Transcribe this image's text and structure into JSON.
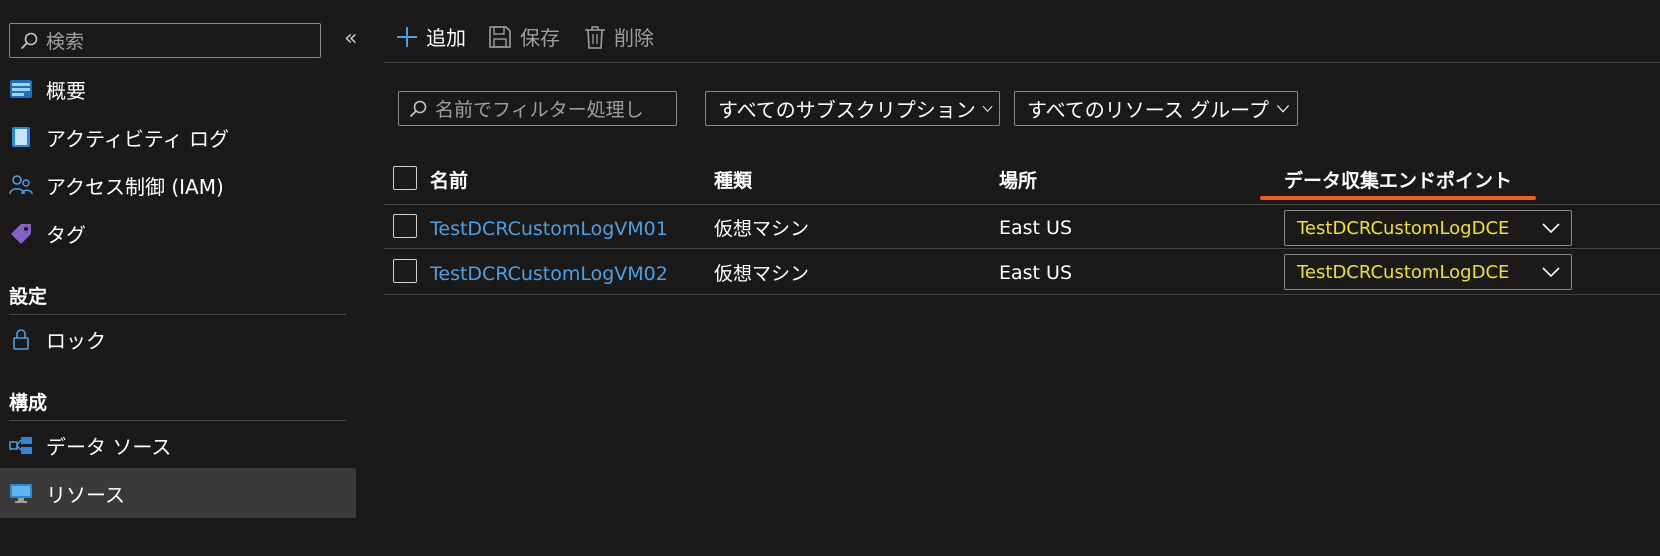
{
  "sidebar": {
    "search_placeholder": "検索",
    "collapse_glyph": "«",
    "items": [
      {
        "label": "概要",
        "icon": "overview-icon"
      },
      {
        "label": "アクティビティ ログ",
        "icon": "activity-log-icon"
      },
      {
        "label": "アクセス制御 (IAM)",
        "icon": "iam-icon"
      },
      {
        "label": "タグ",
        "icon": "tag-icon"
      }
    ],
    "section_settings": "設定",
    "settings_items": [
      {
        "label": "ロック",
        "icon": "lock-icon"
      }
    ],
    "section_config": "構成",
    "config_items": [
      {
        "label": "データ ソース",
        "icon": "data-source-icon"
      },
      {
        "label": "リソース",
        "icon": "resources-icon",
        "selected": true
      }
    ]
  },
  "toolbar": {
    "add_label": "追加",
    "save_label": "保存",
    "delete_label": "削除"
  },
  "filters": {
    "name_placeholder": "名前でフィルター処理し",
    "subscription": "すべてのサブスクリプション",
    "resource_group": "すべてのリソース グループ"
  },
  "table": {
    "headers": {
      "name": "名前",
      "type": "種類",
      "location": "場所",
      "endpoint": "データ収集エンドポイント"
    },
    "rows": [
      {
        "name": "TestDCRCustomLogVM01",
        "type": "仮想マシン",
        "location": "East US",
        "endpoint": "TestDCRCustomLogDCE"
      },
      {
        "name": "TestDCRCustomLogVM02",
        "type": "仮想マシン",
        "location": "East US",
        "endpoint": "TestDCRCustomLogDCE"
      }
    ]
  },
  "colors": {
    "background": "#1b1a19",
    "link": "#4aa0e6",
    "endpoint_value": "#f0e12a",
    "highlight_underline": "#f25c1b",
    "selected_nav": "#3b3a39"
  }
}
